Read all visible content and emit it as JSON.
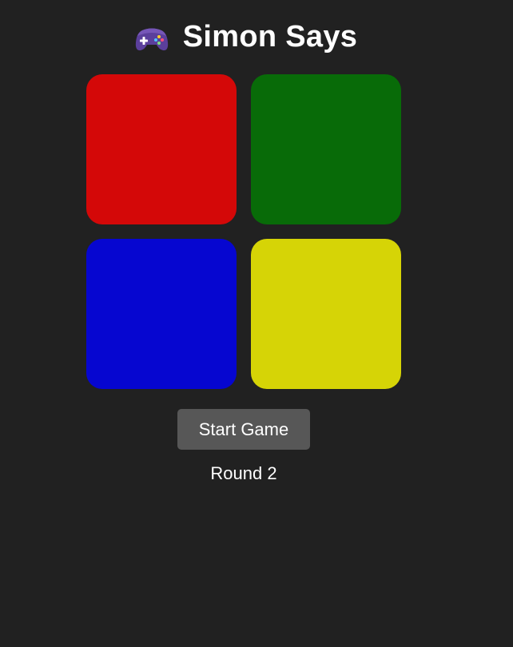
{
  "header": {
    "title": "Simon Says",
    "icon": "video-game-controller-icon"
  },
  "pads": [
    {
      "name": "red",
      "color": "#d40808"
    },
    {
      "name": "green",
      "color": "#086b08"
    },
    {
      "name": "blue",
      "color": "#0606d0"
    },
    {
      "name": "yellow",
      "color": "#d6d406"
    }
  ],
  "controls": {
    "start_label": "Start Game",
    "start_button_color": "#575757"
  },
  "status": {
    "round_text": "Round 2"
  },
  "colors": {
    "background": "#212121",
    "text": "#ffffff"
  }
}
